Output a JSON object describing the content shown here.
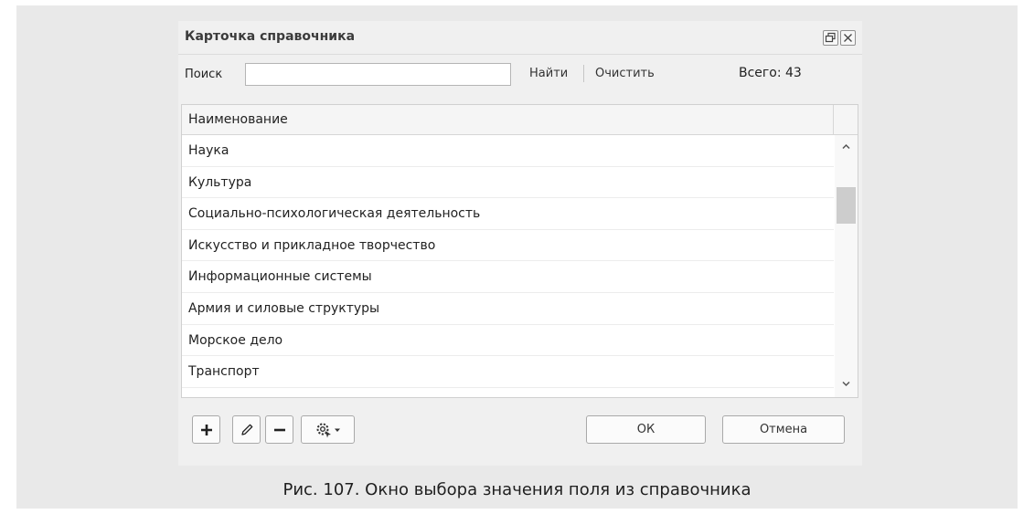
{
  "window": {
    "title": "Карточка справочника"
  },
  "search": {
    "label": "Поиск",
    "value": "",
    "placeholder": "",
    "find_label": "Найти",
    "clear_label": "Очистить",
    "total_text": "Всего: 43"
  },
  "grid": {
    "column_header": "Наименование",
    "rows": [
      "Наука",
      "Культура",
      "Социально-психологическая деятельность",
      "Искусство и прикладное творчество",
      "Информационные системы",
      "Армия и силовые структуры",
      "Морское дело",
      "Транспорт"
    ]
  },
  "footer": {
    "ok_label": "ОК",
    "cancel_label": "Отмена"
  },
  "caption": "Рис. 107. Окно выбора значения поля из справочника"
}
